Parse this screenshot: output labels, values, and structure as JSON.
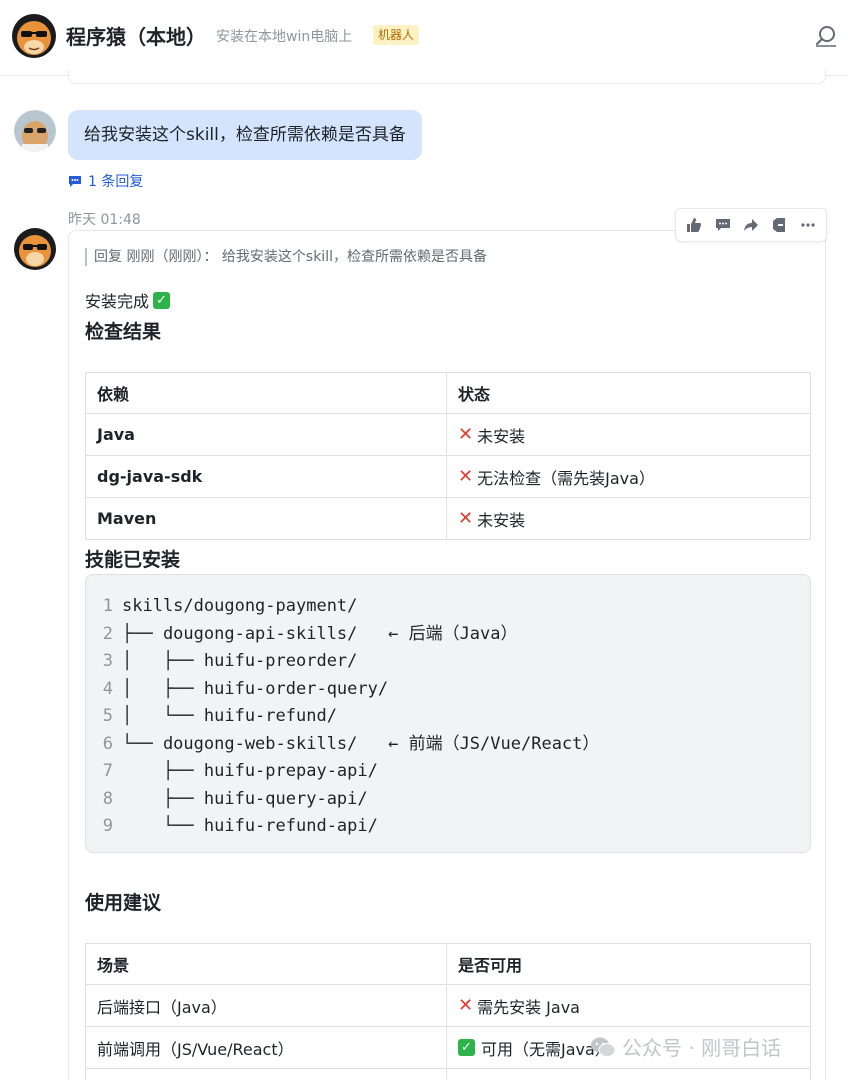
{
  "header": {
    "title": "程序猿（本地）",
    "subtitle": "安装在本地win电脑上",
    "badge": "机器人"
  },
  "user_message": {
    "text": "给我安装这个skill，检查所需依赖是否具备",
    "reply_count": "1 条回复"
  },
  "bot_message": {
    "timestamp": "昨天 01:48",
    "quote": "回复 刚刚（刚刚）：  给我安装这个skill，检查所需依赖是否具备",
    "done_text": "安装完成",
    "check_heading": "检查结果",
    "dep_table": {
      "headers": [
        "依赖",
        "状态"
      ],
      "rows": [
        {
          "name": "Java",
          "status": "未安装"
        },
        {
          "name": "dg-java-sdk",
          "status": "无法检查（需先装Java）"
        },
        {
          "name": "Maven",
          "status": "未安装"
        }
      ]
    },
    "skills_heading": "技能已安装",
    "code_lines": [
      {
        "n": "1",
        "text": "skills/dougong-payment/"
      },
      {
        "n": "2",
        "text": "├── dougong-api-skills/   ← 后端（Java）"
      },
      {
        "n": "3",
        "text": "│   ├── huifu-preorder/"
      },
      {
        "n": "4",
        "text": "│   ├── huifu-order-query/"
      },
      {
        "n": "5",
        "text": "│   └── huifu-refund/"
      },
      {
        "n": "6",
        "text": "└── dougong-web-skills/   ← 前端（JS/Vue/React）"
      },
      {
        "n": "7",
        "text": "    ├── huifu-prepay-api/"
      },
      {
        "n": "8",
        "text": "    ├── huifu-query-api/"
      },
      {
        "n": "9",
        "text": "    └── huifu-refund-api/"
      }
    ],
    "usage_heading": "使用建议",
    "usage_table": {
      "headers": [
        "场景",
        "是否可用"
      ],
      "rows": [
        {
          "scene": "后端接口（Java）",
          "status": "需先安装 Java",
          "ok": false
        },
        {
          "scene": "前端调用（JS/Vue/React）",
          "status": "可用（无需Java）",
          "ok": true
        }
      ]
    }
  },
  "watermark": "公众号 · 刚哥白话",
  "colors": {
    "accent": "#245bdb",
    "user_bubble": "#d4e4fd",
    "badge_bg": "#fdf2c4",
    "cross": "#e53c2f",
    "check": "#2fb249"
  },
  "icons": [
    "bot-avatar-icon",
    "search-icon",
    "comment-icon",
    "thumbs-up-icon",
    "reply-icon",
    "forward-icon",
    "pin-icon",
    "more-icon",
    "cross-icon",
    "check-icon",
    "wechat-icon"
  ]
}
